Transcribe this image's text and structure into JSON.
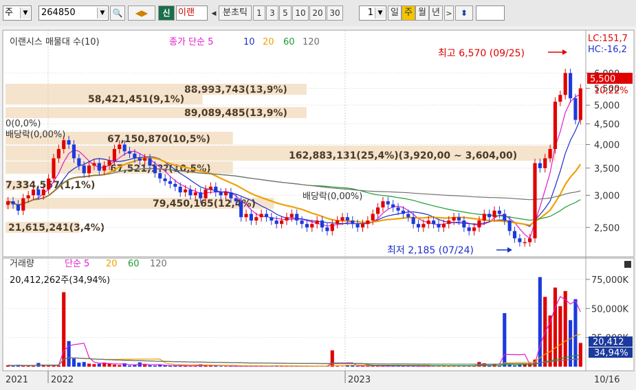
{
  "toolbar": {
    "market_label": "주",
    "code": "264850",
    "new_button": "신",
    "stock_name": "이랜",
    "period_label": "분초틱",
    "intervals": [
      "1",
      "3",
      "5",
      "10",
      "20",
      "30"
    ],
    "count_value": "1",
    "day_label": "일",
    "week_label": "주",
    "month_label": "월",
    "year_label": "년"
  },
  "price_panel": {
    "legend_title": "이랜시스 매물대 수(10)",
    "legend_ma_title": "종가 단순 5",
    "legend_ma": [
      "10",
      "20",
      "60",
      "120"
    ],
    "ma_colors": [
      "#e01ad0",
      "#1c2fc9",
      "#f0a000",
      "#1a9a30",
      "#707070"
    ],
    "lc_label": "LC:151,7",
    "hc_label": "HC:-16,2",
    "current_price": "5,500",
    "current_change": "10,22%",
    "high_annotation": "최고 6,570 (09/25)",
    "low_annotation": "최저 2,185 (07/24)",
    "dividend_labels": [
      "0(0,0%)",
      "배당락(0,00%)",
      "배당락(0,00%)"
    ],
    "volume_profile": [
      {
        "label": "88,993,743(13,9%)",
        "pct": 13.9
      },
      {
        "label": "58,421,451(9,1%)",
        "pct": 9.1
      },
      {
        "label": "89,089,485(13,9%)",
        "pct": 13.9
      },
      {
        "label": "67,150,870(10,5%)",
        "pct": 10.5
      },
      {
        "label": "162,883,131(25,4%)(3,920,00 ~ 3,604,00)",
        "pct": 25.4
      },
      {
        "label": "67,521,1??(10,5%)",
        "pct": 10.5
      },
      {
        "label": "7,334,557(1,1%)",
        "pct": 1.1
      },
      {
        "label": "79,450,165(12,4%)",
        "pct": 12.4
      },
      {
        "label": "21,615,241(3,4%)",
        "pct": 3.4
      }
    ]
  },
  "volume_panel": {
    "legend_title": "거래량",
    "legend_ma_title": "단순 5",
    "legend_ma": [
      "20",
      "60",
      "120"
    ],
    "summary": "20,412,262주(34,94%)",
    "current_volume": "20,412",
    "current_pct": "34,94%"
  },
  "x_axis": {
    "labels": [
      "2021",
      "2022",
      "2023"
    ],
    "last_date": "10/16"
  },
  "chart_data": {
    "type": "candlestick",
    "price_axis": {
      "ticks": [
        "6,000",
        "5,500",
        "5,000",
        "4,500",
        "4,000",
        "3,500",
        "3,000",
        "2,500"
      ],
      "scale": "log"
    },
    "volume_axis": {
      "ticks": [
        "75,000K",
        "50,000K",
        "25,000K"
      ]
    },
    "volume_ticks": [
      75000,
      50000,
      25000
    ],
    "price_ticks": [
      6000,
      5500,
      5000,
      4500,
      4000,
      3500,
      3000,
      2500
    ],
    "closes": [
      2900,
      2850,
      2750,
      2950,
      3000,
      3100,
      3000,
      3100,
      3300,
      3700,
      3900,
      4100,
      4000,
      3700,
      3550,
      3400,
      3550,
      3600,
      3450,
      3550,
      3650,
      3900,
      4000,
      3850,
      3800,
      3700,
      3650,
      3700,
      3550,
      3400,
      3300,
      3250,
      3200,
      3150,
      3050,
      3100,
      3000,
      3050,
      2950,
      3100,
      3150,
      3050,
      3000,
      3050,
      2950,
      2900,
      2650,
      2700,
      2600,
      2650,
      2700,
      2650,
      2600,
      2550,
      2600,
      2650,
      2700,
      2600,
      2550,
      2500,
      2550,
      2600,
      2500,
      2450,
      2550,
      2600,
      2650,
      2600,
      2550,
      2500,
      2550,
      2600,
      2700,
      2800,
      2900,
      2850,
      2800,
      2750,
      2700,
      2650,
      2550,
      2500,
      2550,
      2600,
      2550,
      2500,
      2550,
      2600,
      2650,
      2600,
      2500,
      2450,
      2500,
      2600,
      2700,
      2650,
      2750,
      2700,
      2600,
      2450,
      2350,
      2300,
      2300,
      2350,
      3600,
      3500,
      3700,
      3900,
      5100,
      5300,
      6000,
      5200,
      4600,
      5500
    ],
    "volumes": [
      1200,
      900,
      1500,
      1000,
      800,
      700,
      3200,
      1100,
      800,
      900,
      1000,
      64000,
      22000,
      7000,
      3500,
      4000,
      2600,
      2200,
      2500,
      3500,
      2400,
      1800,
      1300,
      2900,
      1000,
      1300,
      3700,
      1600,
      1200,
      900,
      1400,
      1000,
      700,
      900,
      600,
      800,
      500,
      700,
      2200,
      1000,
      1100,
      800,
      500,
      400,
      600,
      500,
      500,
      400,
      400,
      900,
      600,
      500,
      400,
      800,
      600,
      300,
      300,
      600,
      400,
      900,
      500,
      400,
      600,
      500,
      14000,
      500,
      300,
      1000,
      900,
      600,
      1200,
      500,
      600,
      500,
      400,
      800,
      900,
      600,
      400,
      500,
      700,
      500,
      400,
      900,
      600,
      500,
      1200,
      800,
      600,
      700,
      900,
      1100,
      800,
      4000,
      2900,
      1200,
      1800,
      700,
      46000,
      2100,
      1000,
      1500,
      2400,
      3100,
      6100,
      77000,
      60000,
      44000,
      68000,
      52000,
      65000,
      40000,
      58000,
      20412
    ]
  }
}
